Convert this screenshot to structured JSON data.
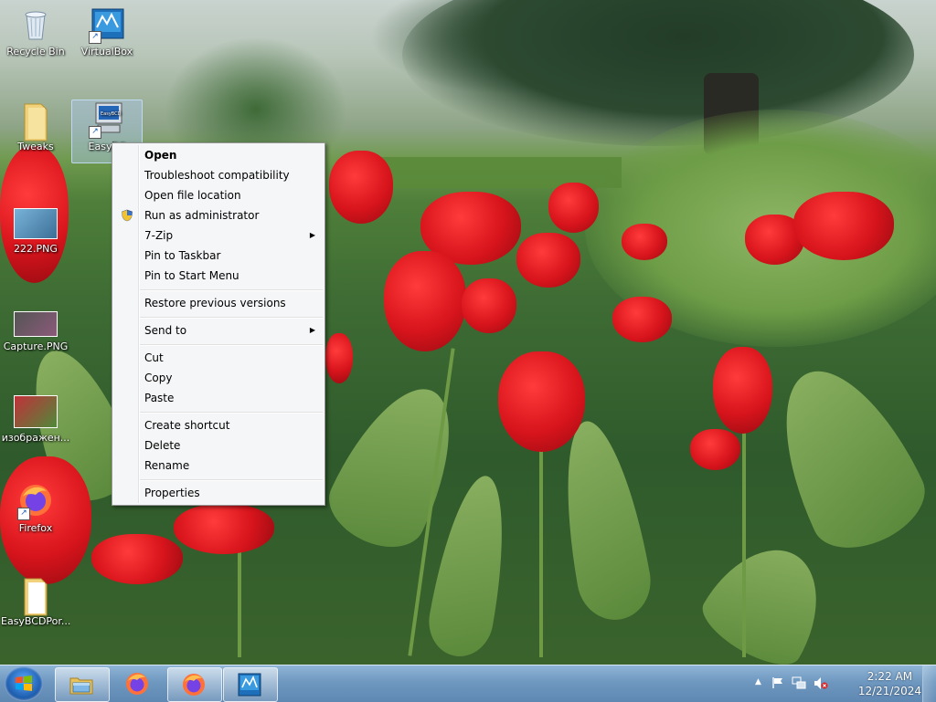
{
  "desktop": {
    "icons": [
      {
        "label": "Recycle Bin"
      },
      {
        "label": "VirtualBox"
      },
      {
        "label": "Tweaks"
      },
      {
        "label": "EasyBC"
      },
      {
        "label": "222.PNG"
      },
      {
        "label": "Capture.PNG"
      },
      {
        "label": "изображен..."
      },
      {
        "label": "Firefox"
      },
      {
        "label": "EasyBCDPor..."
      }
    ]
  },
  "context_menu": {
    "items": [
      {
        "label": "Open"
      },
      {
        "label": "Troubleshoot compatibility"
      },
      {
        "label": "Open file location"
      },
      {
        "label": "Run as administrator"
      },
      {
        "label": "7-Zip"
      },
      {
        "label": "Pin to Taskbar"
      },
      {
        "label": "Pin to Start Menu"
      },
      {
        "label": "Restore previous versions"
      },
      {
        "label": "Send to"
      },
      {
        "label": "Cut"
      },
      {
        "label": "Copy"
      },
      {
        "label": "Paste"
      },
      {
        "label": "Create shortcut"
      },
      {
        "label": "Delete"
      },
      {
        "label": "Rename"
      },
      {
        "label": "Properties"
      }
    ]
  },
  "taskbar": {
    "clock_time": "2:22 AM",
    "clock_date": "12/21/2024"
  },
  "colors": {
    "taskbar": "#6f98c0",
    "menu_bg": "#f5f6f7",
    "firefox": "#ff7139",
    "flower": "#d8141c"
  }
}
